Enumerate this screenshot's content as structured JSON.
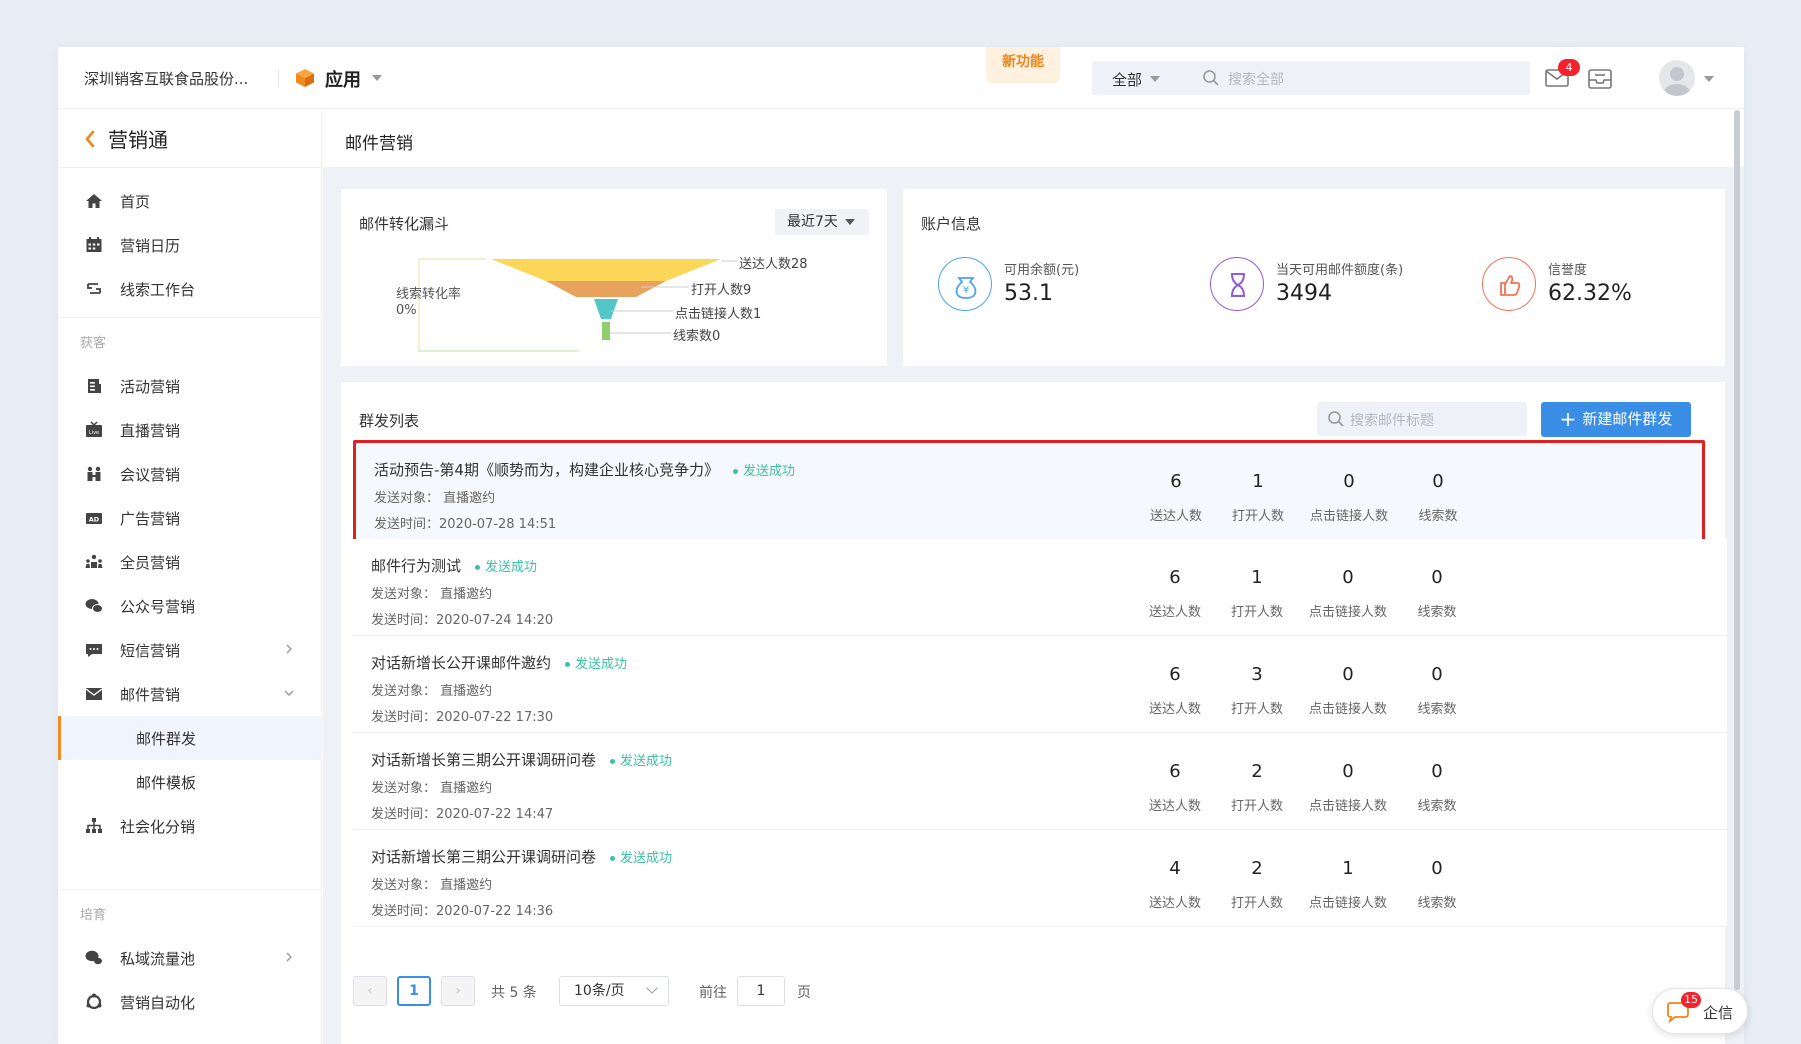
{
  "topbar": {
    "company": "深圳销客互联食品股份...",
    "app_label": "应用",
    "new_feature": "新功能",
    "search_scope": "全部",
    "search_placeholder": "搜索全部",
    "mail_badge": "4"
  },
  "sidebar": {
    "title": "营销通",
    "items_top": [
      {
        "label": "首页",
        "icon": "home-icon"
      },
      {
        "label": "营销日历",
        "icon": "calendar-icon"
      },
      {
        "label": "线索工作台",
        "icon": "leads-desk-icon"
      }
    ],
    "group1": "获客",
    "items_acquire": [
      {
        "label": "活动营销",
        "icon": "activity-icon"
      },
      {
        "label": "直播营销",
        "icon": "live-icon"
      },
      {
        "label": "会议营销",
        "icon": "meeting-icon"
      },
      {
        "label": "广告营销",
        "icon": "ad-icon"
      },
      {
        "label": "全员营销",
        "icon": "staff-icon"
      },
      {
        "label": "公众号营销",
        "icon": "wechat-icon"
      },
      {
        "label": "短信营销",
        "icon": "sms-icon"
      },
      {
        "label": "邮件营销",
        "icon": "mail-icon"
      }
    ],
    "sub_items": [
      {
        "label": "邮件群发",
        "active": true
      },
      {
        "label": "邮件模板",
        "active": false
      }
    ],
    "item_social": {
      "label": "社会化分销",
      "icon": "org-chart-icon"
    },
    "group2": "培育",
    "items_nurture": [
      {
        "label": "私域流量池",
        "icon": "chat-bubbles-icon"
      },
      {
        "label": "营销自动化",
        "icon": "automation-icon"
      }
    ]
  },
  "page": {
    "title": "邮件营销"
  },
  "funnel": {
    "title": "邮件转化漏斗",
    "range": "最近7天",
    "conversion_label": "线索转化率",
    "conversion_value": "0%",
    "chart_data": {
      "type": "funnel",
      "stages": [
        {
          "label": "送达人数28",
          "value": 28,
          "color": "#fbd659"
        },
        {
          "label": "打开人数9",
          "value": 9,
          "color": "#e9a25e"
        },
        {
          "label": "点击链接人数1",
          "value": 1,
          "color": "#53c7c7"
        },
        {
          "label": "线索数0",
          "value": 0,
          "color": "#8fd06c"
        }
      ]
    }
  },
  "account": {
    "title": "账户信息",
    "items": [
      {
        "label": "可用余额(元)",
        "value": "53.1",
        "icon": "money-bag-icon",
        "color": "#4aa3f0"
      },
      {
        "label": "当天可用邮件额度(条)",
        "value": "3494",
        "icon": "hourglass-icon",
        "color": "#8f5ce0"
      },
      {
        "label": "信誉度",
        "value": "62.32%",
        "icon": "thumbs-up-icon",
        "color": "#f07355"
      }
    ]
  },
  "list": {
    "title": "群发列表",
    "search_placeholder": "搜索邮件标题",
    "new_button": "新建邮件群发",
    "stat_captions": [
      "送达人数",
      "打开人数",
      "点击链接人数",
      "线索数"
    ],
    "rows": [
      {
        "name": "活动预告-第4期《顺势而为，构建企业核心竞争力》",
        "status": "发送成功",
        "target": "发送对象： 直播邀约",
        "time": "发送时间：2020-07-28 14:51",
        "stats": [
          "6",
          "1",
          "0",
          "0"
        ]
      },
      {
        "name": "邮件行为测试",
        "status": "发送成功",
        "target": "发送对象： 直播邀约",
        "time": "发送时间：2020-07-24 14:20",
        "stats": [
          "6",
          "1",
          "0",
          "0"
        ]
      },
      {
        "name": "对话新增长公开课邮件邀约",
        "status": "发送成功",
        "target": "发送对象： 直播邀约",
        "time": "发送时间：2020-07-22 17:30",
        "stats": [
          "6",
          "3",
          "0",
          "0"
        ]
      },
      {
        "name": "对话新增长第三期公开课调研问卷",
        "status": "发送成功",
        "target": "发送对象： 直播邀约",
        "time": "发送时间：2020-07-22 14:47",
        "stats": [
          "6",
          "2",
          "0",
          "0"
        ]
      },
      {
        "name": "对话新增长第三期公开课调研问卷",
        "status": "发送成功",
        "target": "发送对象： 直播邀约",
        "time": "发送时间：2020-07-22 14:36",
        "stats": [
          "4",
          "2",
          "1",
          "0"
        ]
      }
    ]
  },
  "pager": {
    "prev": "‹",
    "current": "1",
    "next": "›",
    "total": "共 5 条",
    "page_size": "10条/页",
    "goto_prefix": "前往",
    "goto_value": "1",
    "goto_suffix": "页"
  },
  "qixin": {
    "label": "企信",
    "badge": "15"
  }
}
